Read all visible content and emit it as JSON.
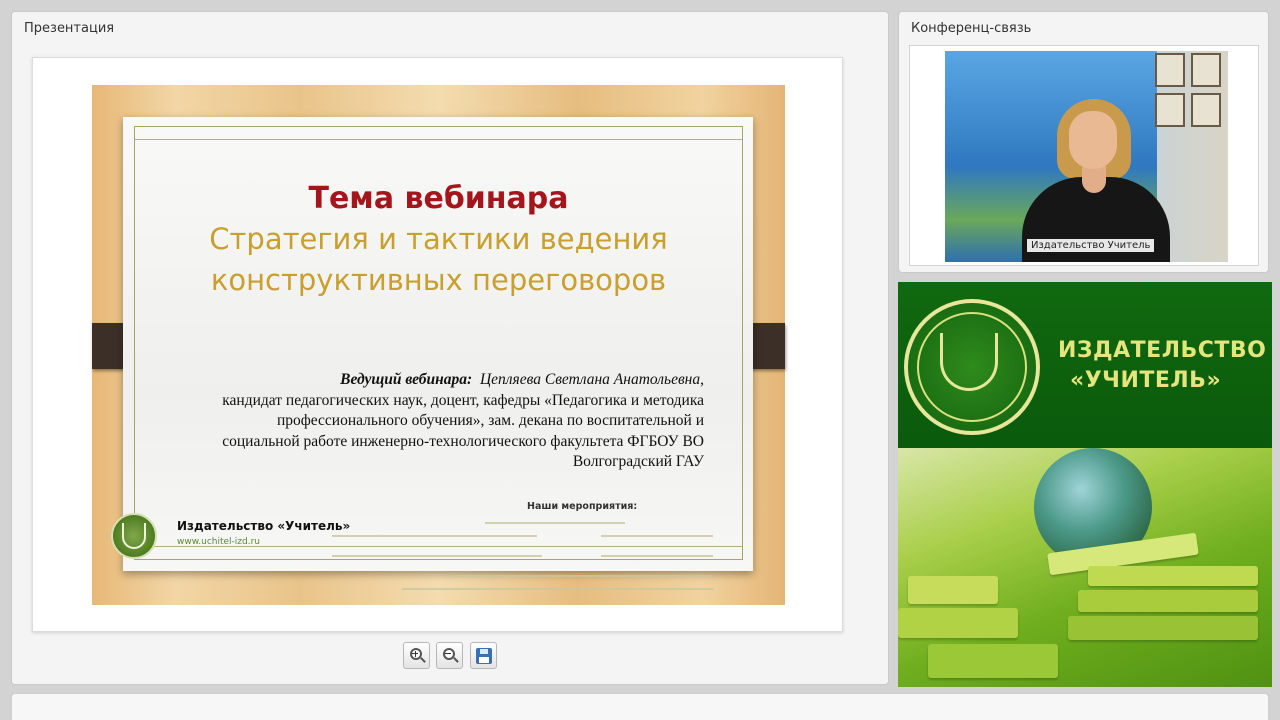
{
  "presentation": {
    "title": "Презентация",
    "slide": {
      "heading": "Тема вебинара",
      "subtitle_line1": "Стратегия и тактики ведения",
      "subtitle_line2": "конструктивных переговоров",
      "host_lead": "Ведущий вебинара",
      "host_name": "Цепляева Светлана Анатольевна,",
      "host_line2": "кандидат педагогических наук,  доцент, кафедры «Педагогика и методика",
      "host_line3": "профессионального обучения», зам. декана по воспитательной и",
      "host_line4": "социальной работе инженерно-технологического факультета ФГБОУ ВО",
      "host_line5": "Волгоградский ГАУ",
      "publisher": "Издательство «Учитель»",
      "publisher_url": "www.uchitel-izd.ru",
      "events_label": "Наши мероприятия:"
    },
    "toolbar": {
      "zoom_in_icon": "zoom-in-icon",
      "zoom_out_icon": "zoom-out-icon",
      "save_icon": "floppy-disk-icon"
    }
  },
  "conference": {
    "title": "Конференц-связь",
    "video_label": "Издательство Учитель"
  },
  "advert": {
    "line1": "ИЗДАТЕЛЬСТВО",
    "line2": "«УЧИТЕЛЬ»"
  },
  "colors": {
    "heading_red": "#a4161b",
    "subtitle_gold": "#c9a02e",
    "ad_green": "#0a5a0b",
    "ad_text": "#e4e57c"
  }
}
